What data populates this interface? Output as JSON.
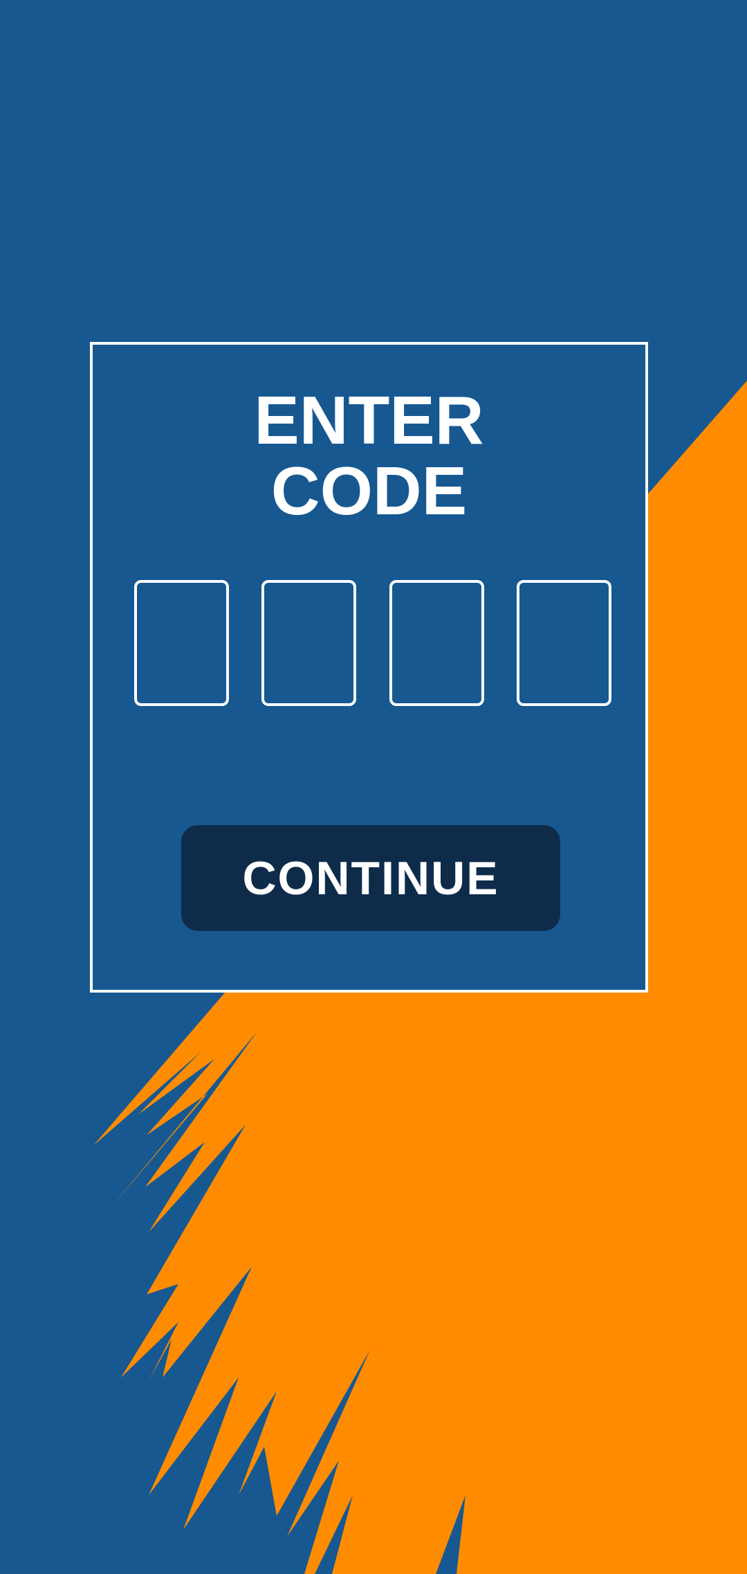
{
  "colors": {
    "background": "#175891",
    "accent": "#FF8C00",
    "button": "#0E2C4A",
    "text": "#FFFFFF"
  },
  "title": {
    "line1": "ENTER",
    "line2": "CODE"
  },
  "code": {
    "digits": [
      "",
      "",
      "",
      ""
    ]
  },
  "continue_label": "CONTINUE"
}
